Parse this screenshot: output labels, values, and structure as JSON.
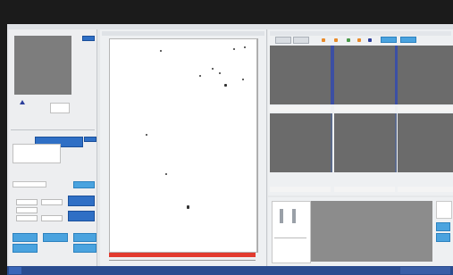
{
  "window": {
    "title": "",
    "subtitle": ""
  },
  "left_panel": {
    "preview_label": "",
    "fields": [
      "",
      "",
      ""
    ],
    "params": [
      "",
      "",
      "",
      "",
      ""
    ],
    "buttons": [
      "",
      "",
      "",
      "",
      ""
    ]
  },
  "plot_panel": {
    "x_ticks": [
      "",
      "",
      "",
      "",
      "",
      ""
    ],
    "y_ticks": [
      "",
      "",
      "",
      "",
      "",
      ""
    ]
  },
  "image_panel": {
    "toolbar_tabs": [
      "",
      "",
      "",
      "",
      "",
      ""
    ],
    "thumb_captions": [
      "",
      "",
      "",
      "",
      "",
      ""
    ]
  },
  "status_panel": {
    "label": ""
  },
  "taskbar": {
    "items": [
      "",
      "",
      "",
      "",
      "",
      ""
    ]
  },
  "colors": {
    "accent_blue": "#2f6fc5",
    "light_blue": "#4aa3df",
    "red_bar": "#e23b2f",
    "thumb_grey": "#6b6b6b"
  }
}
